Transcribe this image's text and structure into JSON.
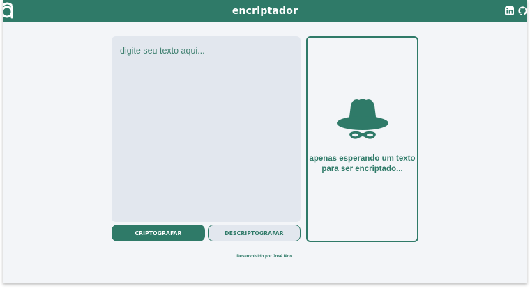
{
  "header": {
    "title": "encriptador",
    "logo_icon": "alura-logo-icon",
    "links": [
      {
        "name": "linkedin",
        "icon": "linkedin-icon"
      },
      {
        "name": "github",
        "icon": "github-icon"
      }
    ]
  },
  "input": {
    "placeholder": "digite seu texto aqui...",
    "value": ""
  },
  "buttons": {
    "encrypt_label": "CRIPTOGRAFAR",
    "decrypt_label": "DESCRIPTOGRAFAR"
  },
  "output": {
    "icon": "spy-icon",
    "message": "apenas esperando um texto para ser encriptado..."
  },
  "footer": {
    "text": "Desenvolvido por José Iêdo."
  },
  "colors": {
    "primary": "#2f7a68",
    "background": "#f3f5f8",
    "input_background": "#e2e7ee",
    "header_text": "#ffffff"
  }
}
